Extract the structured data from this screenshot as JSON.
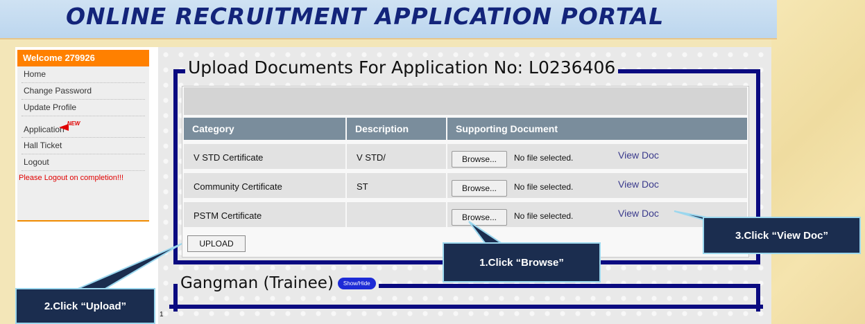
{
  "header": {
    "title": "ONLINE RECRUITMENT APPLICATION PORTAL"
  },
  "sidebar": {
    "welcome": "Welcome 279926",
    "items": [
      {
        "label": "Home"
      },
      {
        "label": "Change Password"
      },
      {
        "label": "Update Profile"
      },
      {
        "label": "Application",
        "badge": "NEW"
      },
      {
        "label": "Hall Ticket"
      },
      {
        "label": "Logout"
      }
    ],
    "note": "Please Logout on completion!!!"
  },
  "upload_section": {
    "legend": "Upload Documents For Application No: L0236406",
    "columns": [
      "Category",
      "Description",
      "Supporting Document"
    ],
    "rows": [
      {
        "category": "V STD Certificate",
        "description": "V STD/",
        "browse": "Browse...",
        "file_status": "No file selected.",
        "view": "View Doc"
      },
      {
        "category": "Community Certificate",
        "description": "ST",
        "browse": "Browse...",
        "file_status": "No file selected.",
        "view": "View Doc"
      },
      {
        "category": "PSTM Certificate",
        "description": "",
        "browse": "Browse...",
        "file_status": "No file selected.",
        "view": "View Doc"
      }
    ],
    "upload_label": "UPLOAD"
  },
  "next_section": {
    "legend": "Gangman (Trainee)",
    "toggle": "Show/Hide"
  },
  "page_number": "1",
  "callouts": {
    "browse": "1.Click “Browse”",
    "upload": "2.Click “Upload”",
    "view": "3.Click “View Doc”"
  },
  "colors": {
    "header_title": "#13247a",
    "sidebar_accent": "#ff8000",
    "frame": "#0a0a80",
    "callout_bg": "#1b2d4f",
    "callout_border": "#9bd7ee"
  }
}
